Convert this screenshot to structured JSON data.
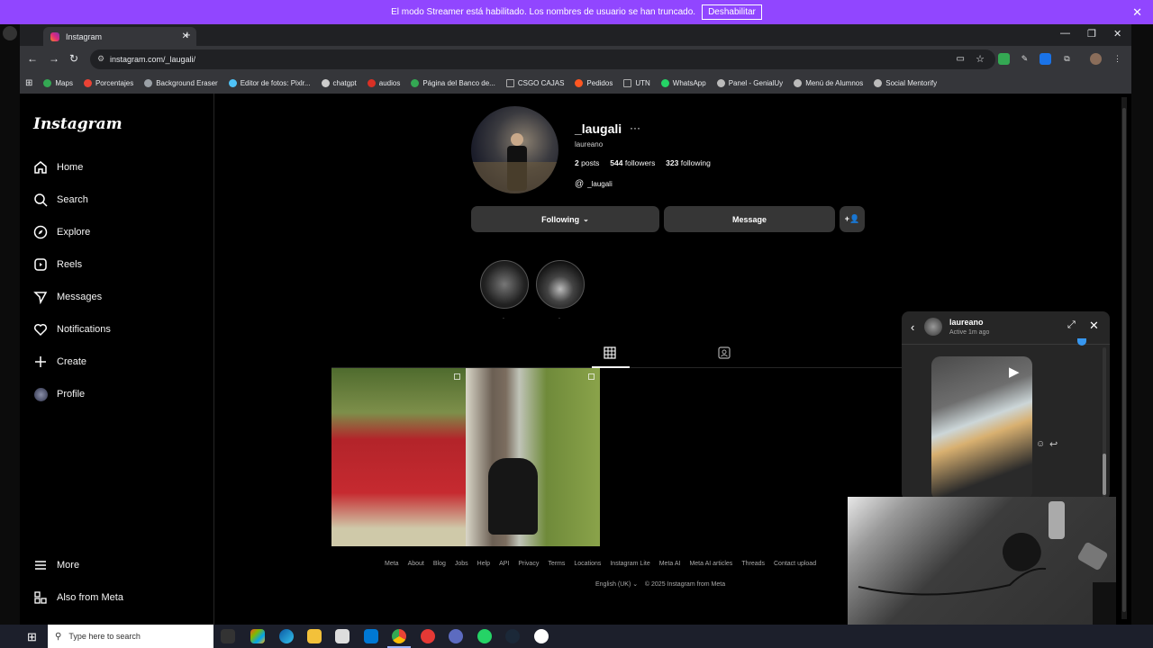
{
  "streamer_bar": {
    "message": "El modo Streamer está habilitado. Los nombres de usuario se han truncado.",
    "button": "Deshabilitar"
  },
  "browser": {
    "tab_title": "Instagram",
    "url": "instagram.com/_laugali/",
    "bookmarks": [
      {
        "label": "Maps",
        "color": "#34a853"
      },
      {
        "label": "Porcentajes",
        "color": "#ea4335"
      },
      {
        "label": "Background Eraser",
        "color": "#9aa0a6"
      },
      {
        "label": "Editor de fotos: Pixlr...",
        "color": "#4fc3f7"
      },
      {
        "label": "chatgpt",
        "color": "#cccccc"
      },
      {
        "label": "audios",
        "color": "#d93025"
      },
      {
        "label": "Página del Banco de...",
        "color": "#34a853"
      },
      {
        "label": "CSGO CAJAS",
        "color": "#9aa0a6"
      },
      {
        "label": "Pedidos",
        "color": "#ff5722"
      },
      {
        "label": "UTN",
        "color": "#9aa0a6"
      },
      {
        "label": "WhatsApp",
        "color": "#25d366"
      },
      {
        "label": "Panel - GenialUy",
        "color": "#bbbbbb"
      },
      {
        "label": "Menú de Alumnos",
        "color": "#bbbbbb"
      },
      {
        "label": "Social Mentorify",
        "color": "#bbbbbb"
      }
    ]
  },
  "instagram": {
    "logo": "Instagram",
    "nav": [
      {
        "label": "Home",
        "icon": "home-icon"
      },
      {
        "label": "Search",
        "icon": "search-icon"
      },
      {
        "label": "Explore",
        "icon": "compass-icon"
      },
      {
        "label": "Reels",
        "icon": "reels-icon"
      },
      {
        "label": "Messages",
        "icon": "messages-icon"
      },
      {
        "label": "Notifications",
        "icon": "heart-icon"
      },
      {
        "label": "Create",
        "icon": "plus-icon"
      },
      {
        "label": "Profile",
        "icon": "profile-avatar"
      }
    ],
    "more": "More",
    "also_meta": "Also from Meta",
    "profile": {
      "username": "_laugali",
      "name": "laureano",
      "posts_count": "2",
      "posts_label": "posts",
      "followers_count": "544",
      "followers_label": "followers",
      "following_count": "323",
      "following_label": "following",
      "threads": "_laugali",
      "following_button": "Following",
      "message_button": "Message"
    },
    "highlights": [
      {
        "label": "."
      },
      {
        "label": "."
      }
    ],
    "footer_links": [
      "Meta",
      "About",
      "Blog",
      "Jobs",
      "Help",
      "API",
      "Privacy",
      "Terms",
      "Locations",
      "Instagram Lite",
      "Meta AI",
      "Meta AI articles",
      "Threads",
      "Contact upload"
    ],
    "language": "English (UK)",
    "copyright": "© 2025 Instagram from Meta"
  },
  "chat": {
    "name": "laureano",
    "status": "Active 1m ago"
  },
  "taskbar": {
    "search_placeholder": "Type here to search"
  }
}
